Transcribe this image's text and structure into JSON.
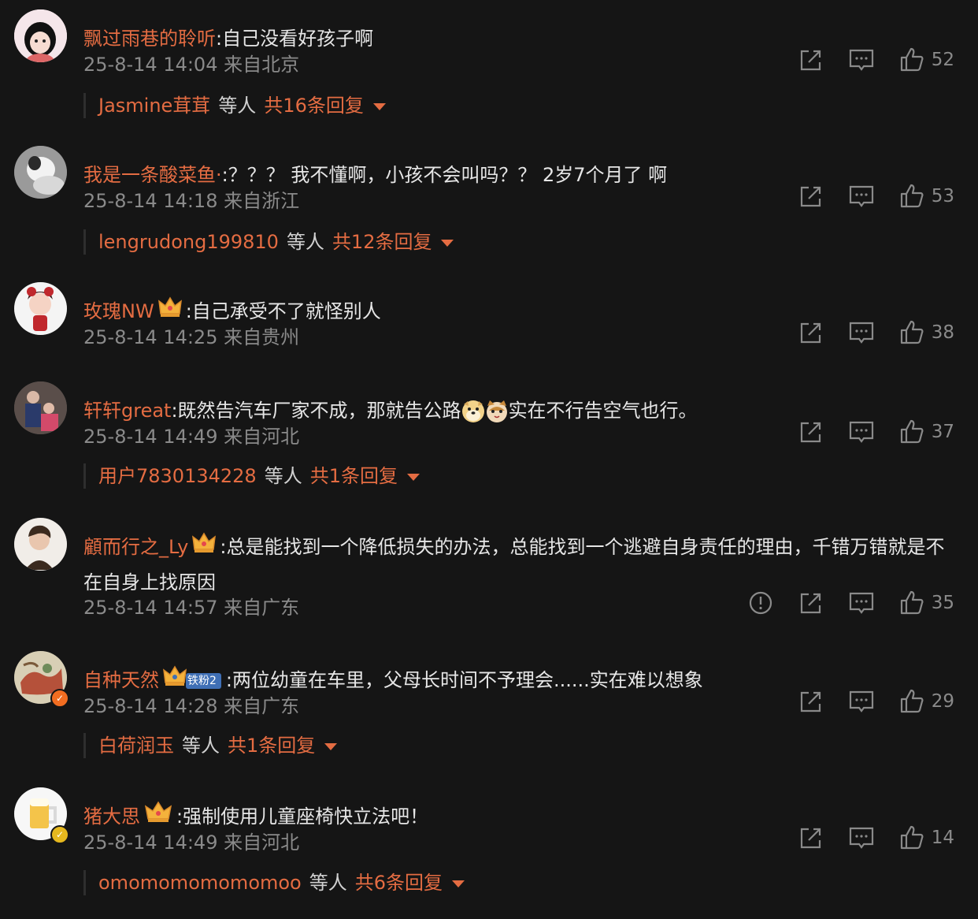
{
  "comments": [
    {
      "username": "飘过雨巷的聆听",
      "text": ":自己没看好孩子啊",
      "time": "25-8-14 14:04",
      "location": "来自北京",
      "likes": "52",
      "reply_name": "Jasmine茸茸",
      "reply_etc": "等人",
      "reply_count": "共16条回复"
    },
    {
      "username": "我是一条酸菜鱼·",
      "text": ":？？？ 我不懂啊，小孩不会叫吗？？ 2岁7个月了 啊",
      "time": "25-8-14 14:18",
      "location": "来自浙江",
      "likes": "53",
      "reply_name": "lengrudong199810",
      "reply_etc": "等人",
      "reply_count": "共12条回复"
    },
    {
      "username": "玫瑰NW",
      "text": ":自己承受不了就怪别人",
      "time": "25-8-14 14:25",
      "location": "来自贵州",
      "likes": "38"
    },
    {
      "username": "轩轩great",
      "text_a": ":既然告汽车厂家不成，那就告公路",
      "text_b": "实在不行告空气也行。",
      "time": "25-8-14 14:49",
      "location": "来自河北",
      "likes": "37",
      "reply_name": "用户7830134228",
      "reply_etc": "等人",
      "reply_count": "共1条回复"
    },
    {
      "username": "顧而行之_Ly",
      "text": ":总是能找到一个降低损失的办法，总能找到一个逃避自身责任的理由，千错万错就是不在自身上找原因",
      "time": "25-8-14 14:57",
      "location": "来自广东",
      "likes": "35"
    },
    {
      "username": "自种天然",
      "fan_badge": "铁粉2",
      "text": ":两位幼童在车里，父母长时间不予理会......实在难以想象",
      "time": "25-8-14 14:28",
      "location": "来自广东",
      "likes": "29",
      "reply_name": "白荷润玉",
      "reply_etc": "等人",
      "reply_count": "共1条回复"
    },
    {
      "username": "猪大思",
      "text": ":强制使用儿童座椅快立法吧！",
      "time": "25-8-14 14:49",
      "location": "来自河北",
      "likes": "14",
      "reply_name": "omomomomomomoo",
      "reply_etc": "等人",
      "reply_count": "共6条回复"
    }
  ],
  "colors": {
    "background": "#151515",
    "username": "#e46c42",
    "meta": "#8a8a8a",
    "text": "#e6e6e6"
  }
}
